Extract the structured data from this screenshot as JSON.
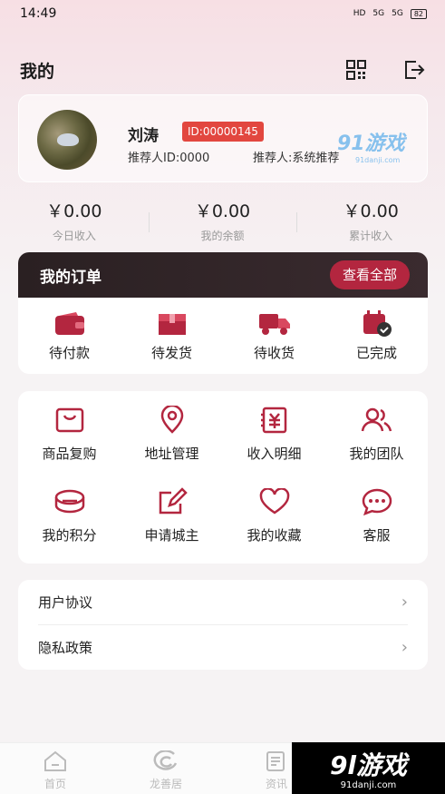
{
  "status": {
    "time": "14:49",
    "signal1": "5G",
    "signal2": "5G",
    "battery": "82"
  },
  "header": {
    "title": "我的",
    "qr_icon": "qr-code-icon",
    "logout_icon": "logout-icon"
  },
  "profile": {
    "name": "刘涛",
    "id_badge": "ID:00000145",
    "referrer_id": "推荐人ID:0000",
    "referrer_name": "推荐人:系统推荐"
  },
  "watermark_top": {
    "text": "91游戏",
    "sub": "91danji.com"
  },
  "stats": [
    {
      "value": "￥0.00",
      "label": "今日收入"
    },
    {
      "value": "￥0.00",
      "label": "我的余额"
    },
    {
      "value": "￥0.00",
      "label": "累计收入"
    }
  ],
  "orders": {
    "title": "我的订单",
    "view_all": "查看全部",
    "items": [
      {
        "label": "待付款",
        "icon": "wallet-icon"
      },
      {
        "label": "待发货",
        "icon": "box-icon"
      },
      {
        "label": "待收货",
        "icon": "truck-icon"
      },
      {
        "label": "已完成",
        "icon": "completed-icon"
      }
    ]
  },
  "tools": [
    {
      "label": "商品复购",
      "icon": "repurchase-icon"
    },
    {
      "label": "地址管理",
      "icon": "location-icon"
    },
    {
      "label": "收入明细",
      "icon": "income-icon"
    },
    {
      "label": "我的团队",
      "icon": "team-icon"
    },
    {
      "label": "我的积分",
      "icon": "points-icon"
    },
    {
      "label": "申请城主",
      "icon": "edit-icon"
    },
    {
      "label": "我的收藏",
      "icon": "heart-icon"
    },
    {
      "label": "客服",
      "icon": "chat-icon"
    }
  ],
  "links": [
    {
      "label": "用户协议"
    },
    {
      "label": "隐私政策"
    }
  ],
  "tabs": [
    {
      "label": "首页",
      "icon": "home-icon"
    },
    {
      "label": "龙善居",
      "icon": "brand-icon"
    },
    {
      "label": "资讯",
      "icon": "news-icon"
    }
  ],
  "watermark_bottom": {
    "text": "9l游戏",
    "sub": "91danji.com"
  },
  "colors": {
    "accent": "#b3263f",
    "badge": "#e2473f",
    "icon": "#b3263f"
  }
}
